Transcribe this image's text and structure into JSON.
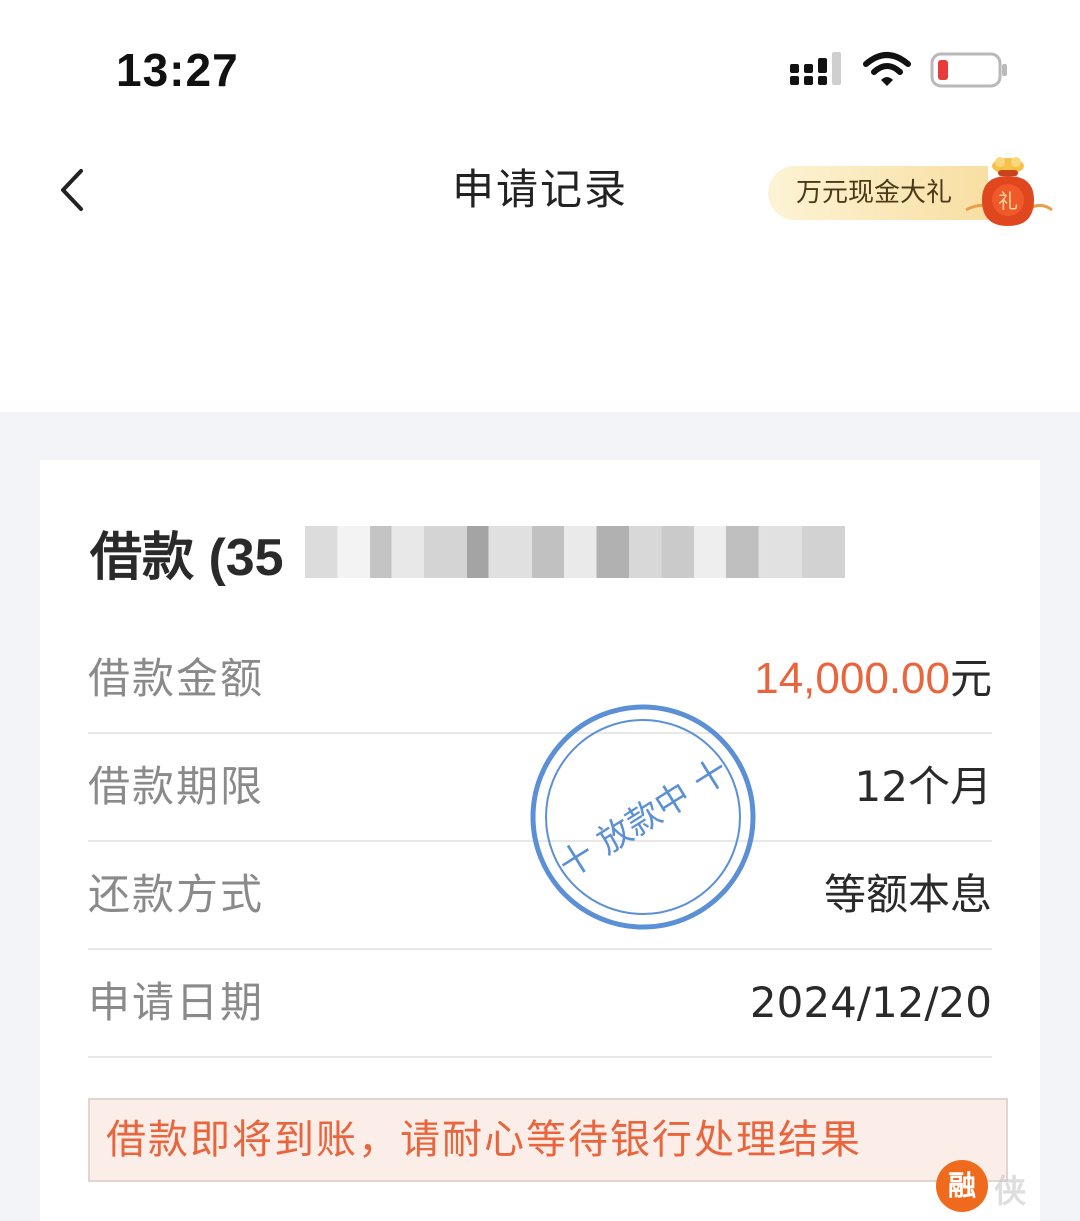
{
  "status_bar": {
    "time": "13:27"
  },
  "nav": {
    "title": "申请记录",
    "promo_label": "万元现金大礼",
    "gift_bag_char": "礼"
  },
  "loan": {
    "heading": "借款 (35",
    "rows": [
      {
        "label": "借款金额",
        "value": "14,000.00",
        "unit": "元"
      },
      {
        "label": "借款期限",
        "value": "12个月"
      },
      {
        "label": "还款方式",
        "value": "等额本息"
      },
      {
        "label": "申请日期",
        "value": "2024/12/20"
      }
    ],
    "notice": "借款即将到账，请耐心等待银行处理结果",
    "stamp_text": "十 放款中 十"
  },
  "watermark": {
    "logo_char": "融",
    "text": "侠"
  },
  "colors": {
    "accent_orange": "#e8653d",
    "stamp_blue": "#5b8fd6",
    "promo_gold": "#f8dfa2",
    "background": "#f3f4f8"
  },
  "icons": {
    "signal": "cellular-signal-icon",
    "wifi": "wifi-icon",
    "battery": "battery-low-icon",
    "back": "chevron-left-icon",
    "gift": "gift-bag-icon"
  }
}
